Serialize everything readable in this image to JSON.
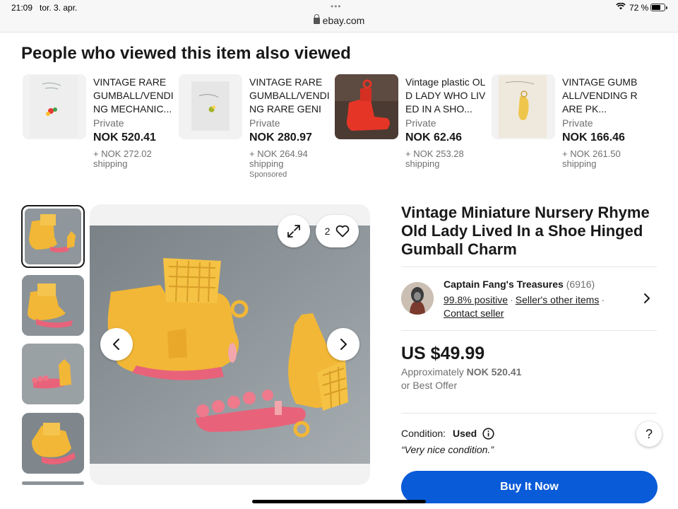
{
  "status_bar": {
    "time": "21:09",
    "date": "tor. 3. apr.",
    "url": "ebay.com",
    "battery": "72 %",
    "battery_level": 0.72
  },
  "also_viewed": {
    "title": "People who viewed this item also viewed",
    "items": [
      {
        "title": "VINTAGE RARE GUMBALL/VENDING MECHANIC...",
        "seller": "Private",
        "price": "NOK 520.41",
        "shipping_line1": "+ NOK 272.02",
        "shipping_line2": "shipping",
        "sponsored": ""
      },
      {
        "title": "VINTAGE RARE GUMBALL/VENDING RARE GENIE...",
        "seller": "Private",
        "price": "NOK 280.97",
        "shipping_line1": "+ NOK 264.94",
        "shipping_line2": "shipping",
        "sponsored": "Sponsored"
      },
      {
        "title": "Vintage plastic OLD LADY WHO LIVED IN A SHO...",
        "seller": "Private",
        "price": "NOK 62.46",
        "shipping_line1": "+ NOK 253.28",
        "shipping_line2": "shipping",
        "sponsored": ""
      },
      {
        "title": "VINTAGE GUMBALL/VENDING RARE PK...",
        "seller": "Private",
        "price": "NOK 166.46",
        "shipping_line1": "+ NOK 261.50",
        "shipping_line2": "shipping",
        "sponsored": ""
      }
    ]
  },
  "gallery": {
    "watch_count": "2"
  },
  "item": {
    "title": "Vintage Miniature Nursery Rhyme Old Lady Lived In a Shoe Hinged Gumball Charm",
    "seller_name": "Captain Fang's Treasures",
    "seller_feedback": "(6916)",
    "positive": "99.8% positive",
    "other_items": "Seller's other items",
    "contact": "Contact seller",
    "price": "US $49.99",
    "approx_label": "Approximately",
    "approx_value": "NOK 520.41",
    "best_offer": "or Best Offer",
    "condition_label": "Condition:",
    "condition_value": "Used",
    "condition_quote": "“Very nice condition.”",
    "buy_label": "Buy It Now",
    "help_label": "?"
  },
  "colors": {
    "accent": "#0a5bd8",
    "toy_yellow": "#f2b736",
    "toy_pink": "#e8637a"
  }
}
